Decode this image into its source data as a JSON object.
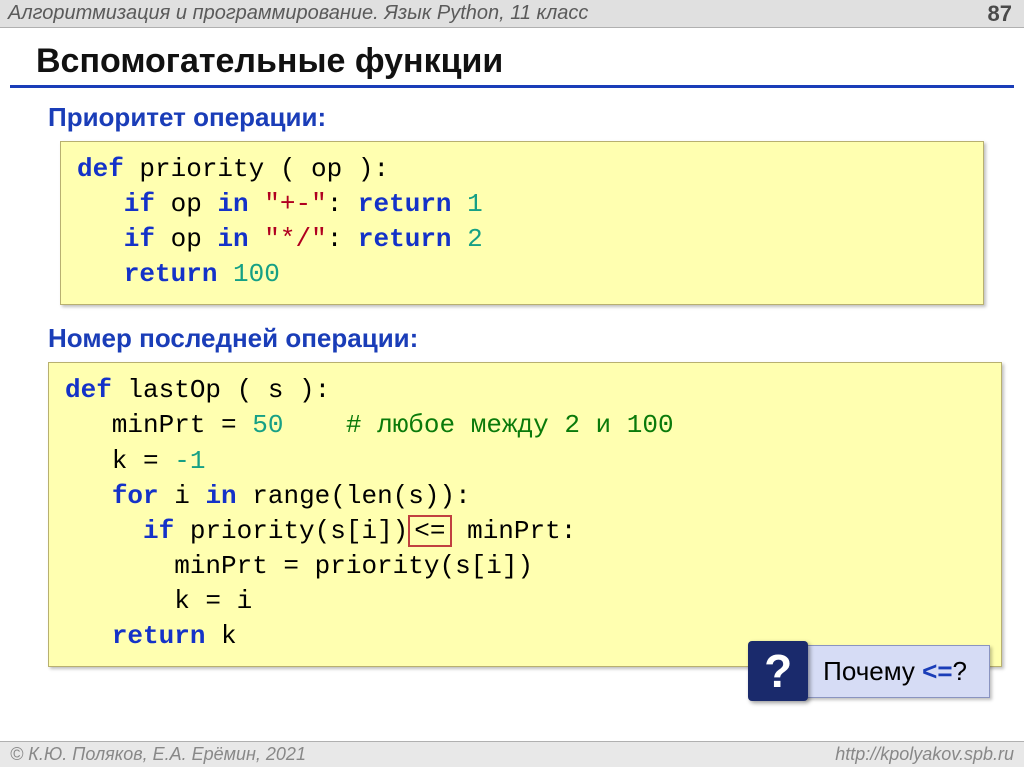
{
  "header": {
    "subject": "Алгоритмизация и программирование. Язык Python, 11 класс",
    "page": "87"
  },
  "title": "Вспомогательные функции",
  "section1": "Приоритет операции:",
  "code1": {
    "l1_def": "def",
    "l1_name": " priority",
    "l1_rest": " ( op ):",
    "l2_if": "   if",
    "l2_mid": " op ",
    "l2_in": "in",
    "l2_sp": " ",
    "l2_str": "\"+-\"",
    "l2_colon": ": ",
    "l2_ret": "return",
    "l2_num": " 1",
    "l3_str": "\"*/\"",
    "l3_num": " 2",
    "l4_pad": "   ",
    "l4_ret": "return",
    "l4_num": " 100"
  },
  "section2": "Номер последней операции:",
  "code2": {
    "l1_def": "def",
    "l1_name": " lastOp",
    "l1_rest": " ( s ):",
    "l2a": "   minPrt",
    "l2b": " = ",
    "l2num": "50",
    "l2pad": "    ",
    "l2comment": "# любое между 2 и 100",
    "l3a": "   k",
    "l3b": " = ",
    "l3num": "-1",
    "l4_pad": "   ",
    "l4_for": "for",
    "l4_mid1": " i ",
    "l4_in": "in",
    "l4_mid2": " range(len(s)):",
    "l5_pad": "     ",
    "l5_if": "if",
    "l5_mid1": " priority(s[i])",
    "l5_op": "<=",
    "l5_mid2": " minPrt:",
    "l6": "       minPrt = priority(s[i])",
    "l7": "       k = i",
    "l8_pad": "   ",
    "l8_ret": "return",
    "l8_rest": " k"
  },
  "callout": {
    "mark": "?",
    "text1": "Почему ",
    "op": "<=",
    "text2": "?"
  },
  "footer": {
    "authors": "© К.Ю. Поляков, Е.А. Ерёмин, 2021",
    "url": "http://kpolyakov.spb.ru"
  }
}
